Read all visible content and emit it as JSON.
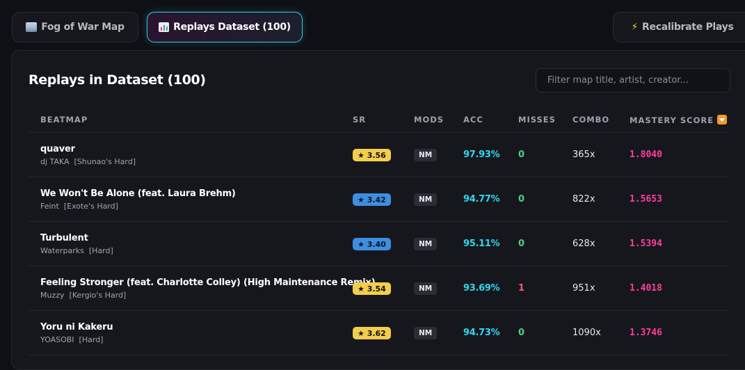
{
  "tabs": {
    "fog": {
      "label": "Fog of War Map",
      "icon": "map-icon"
    },
    "replays": {
      "label": "Replays Dataset (100)",
      "icon": "bar-chart-icon"
    },
    "recalibrate": {
      "label": "Recalibrate Plays",
      "icon": "lightning-bolt-icon",
      "glyph": "⚡"
    }
  },
  "panel": {
    "title": "Replays in Dataset (100)",
    "filter_placeholder": "Filter map title, artist, creator..."
  },
  "columns": {
    "beatmap": "BEATMAP",
    "sr": "SR",
    "mods": "MODS",
    "acc": "ACC",
    "misses": "MISSES",
    "combo": "COMBO",
    "mastery": "MASTERY SCORE"
  },
  "sort_icon": "sort-down-icon",
  "colors": {
    "accent_cyan": "#2fd8ee",
    "mastery_pink": "#ff3f9e",
    "miss_zero": "#4bd27a",
    "miss_some": "#ff5a6e",
    "sr_yellow": "#f3cd4c",
    "sr_blue": "#3d8fe0"
  },
  "rows": [
    {
      "title": "quaver",
      "artist": "dj TAKA",
      "difficulty": "[Shunao's Hard]",
      "sr": "★ 3.56",
      "sr_color": "yellow",
      "mods": "NM",
      "acc": "97.93%",
      "misses": "0",
      "combo": "365x",
      "mastery": "1.8040"
    },
    {
      "title": "We Won't Be Alone (feat. Laura Brehm)",
      "artist": "Feint",
      "difficulty": "[Exote's Hard]",
      "sr": "★ 3.42",
      "sr_color": "blue",
      "mods": "NM",
      "acc": "94.77%",
      "misses": "0",
      "combo": "822x",
      "mastery": "1.5653"
    },
    {
      "title": "Turbulent",
      "artist": "Waterparks",
      "difficulty": "[Hard]",
      "sr": "★ 3.40",
      "sr_color": "blue",
      "mods": "NM",
      "acc": "95.11%",
      "misses": "0",
      "combo": "628x",
      "mastery": "1.5394"
    },
    {
      "title": "Feeling Stronger (feat. Charlotte Colley) (High Maintenance Remix)",
      "artist": "Muzzy",
      "difficulty": "[Kergio's Hard]",
      "sr": "★ 3.54",
      "sr_color": "yellow",
      "mods": "NM",
      "acc": "93.69%",
      "misses": "1",
      "combo": "951x",
      "mastery": "1.4018"
    },
    {
      "title": "Yoru ni Kakeru",
      "artist": "YOASOBI",
      "difficulty": "[Hard]",
      "sr": "★ 3.62",
      "sr_color": "yellow",
      "mods": "NM",
      "acc": "94.73%",
      "misses": "0",
      "combo": "1090x",
      "mastery": "1.3746"
    }
  ]
}
